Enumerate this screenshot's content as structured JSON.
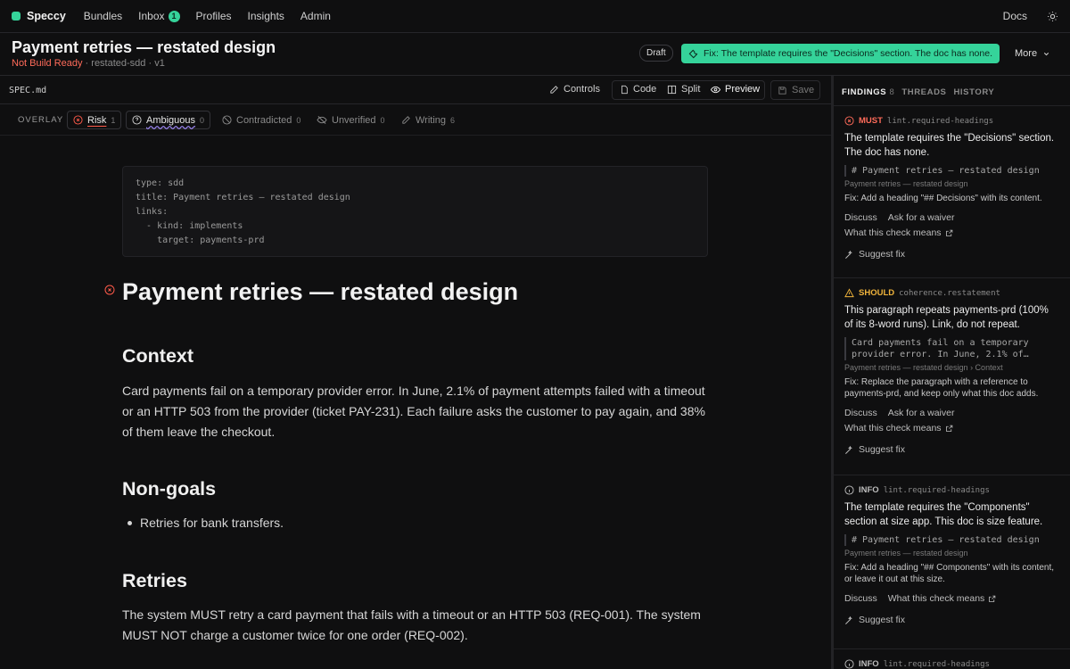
{
  "nav": {
    "brand": "Speccy",
    "items": [
      "Bundles",
      "Inbox",
      "Profiles",
      "Insights",
      "Admin"
    ],
    "inbox_count": "1",
    "docs": "Docs"
  },
  "header": {
    "title": "Payment retries — restated design",
    "status": "Not Build Ready",
    "meta": " · restated-sdd · v1",
    "draft": "Draft",
    "fix_banner": "Fix: The template requires the \"Decisions\" section. The doc has none.",
    "more": "More"
  },
  "editor": {
    "filename": "SPEC.md",
    "controls": "Controls",
    "code": "Code",
    "split": "Split",
    "preview": "Preview",
    "save": "Save"
  },
  "overlay": {
    "label": "OVERLAY",
    "chips": [
      {
        "label": "Risk",
        "count": "1"
      },
      {
        "label": "Ambiguous",
        "count": "0"
      },
      {
        "label": "Contradicted",
        "count": "0"
      },
      {
        "label": "Unverified",
        "count": "0"
      },
      {
        "label": "Writing",
        "count": "6"
      }
    ]
  },
  "doc": {
    "frontmatter": [
      "type: sdd",
      "title: Payment retries — restated design",
      "links:",
      "  - kind: implements",
      "    target: payments-prd"
    ],
    "h1": "Payment retries — restated design",
    "context_h": "Context",
    "context_p": "Card payments fail on a temporary provider error. In June, 2.1% of payment attempts failed with a timeout or an HTTP 503 from the provider (ticket PAY-231). Each failure asks the customer to pay again, and 38% of them leave the checkout.",
    "nongoals_h": "Non-goals",
    "nongoals_item": "Retries for bank transfers.",
    "retries_h": "Retries",
    "retries_p": "The system MUST retry a card payment that fails with a timeout or an HTTP 503 (REQ-001). The system MUST NOT charge a customer twice for one order (REQ-002)."
  },
  "panel": {
    "tabs": {
      "findings": "FINDINGS",
      "findings_count": "8",
      "threads": "THREADS",
      "history": "HISTORY"
    },
    "findings": [
      {
        "severity": "MUST",
        "rule": "lint.required-headings",
        "message": "The template requires the \"Decisions\" section. The doc has none.",
        "quote": "# Payment retries — restated design",
        "crumb": "Payment retries — restated design",
        "fix": "Fix: Add a heading \"## Decisions\" with its content.",
        "discuss": "Discuss",
        "waiver": "Ask for a waiver",
        "check": "What this check means",
        "suggest": "Suggest fix"
      },
      {
        "severity": "SHOULD",
        "rule": "coherence.restatement",
        "message": "This paragraph repeats payments-prd (100% of its 8-word runs). Link, do not repeat.",
        "quote": "Card payments fail on a temporary\nprovider error. In June, 2.1% of…",
        "crumb": "Payment retries — restated design › Context",
        "fix": "Fix: Replace the paragraph with a reference to payments-prd, and keep only what this doc adds.",
        "discuss": "Discuss",
        "waiver": "Ask for a waiver",
        "check": "What this check means",
        "suggest": "Suggest fix"
      },
      {
        "severity": "INFO",
        "rule": "lint.required-headings",
        "message": "The template requires the \"Components\" section at size app. This doc is size feature.",
        "quote": "# Payment retries — restated design",
        "crumb": "Payment retries — restated design",
        "fix": "Fix: Add a heading \"## Components\" with its content, or leave it out at this size.",
        "discuss": "Discuss",
        "check": "What this check means",
        "suggest": "Suggest fix"
      },
      {
        "severity": "INFO",
        "rule": "lint.required-headings"
      }
    ]
  },
  "colors": {
    "accent": "#35d39a",
    "must": "#ff6b5a",
    "should": "#f0b43c",
    "background": "#0f0f10"
  }
}
